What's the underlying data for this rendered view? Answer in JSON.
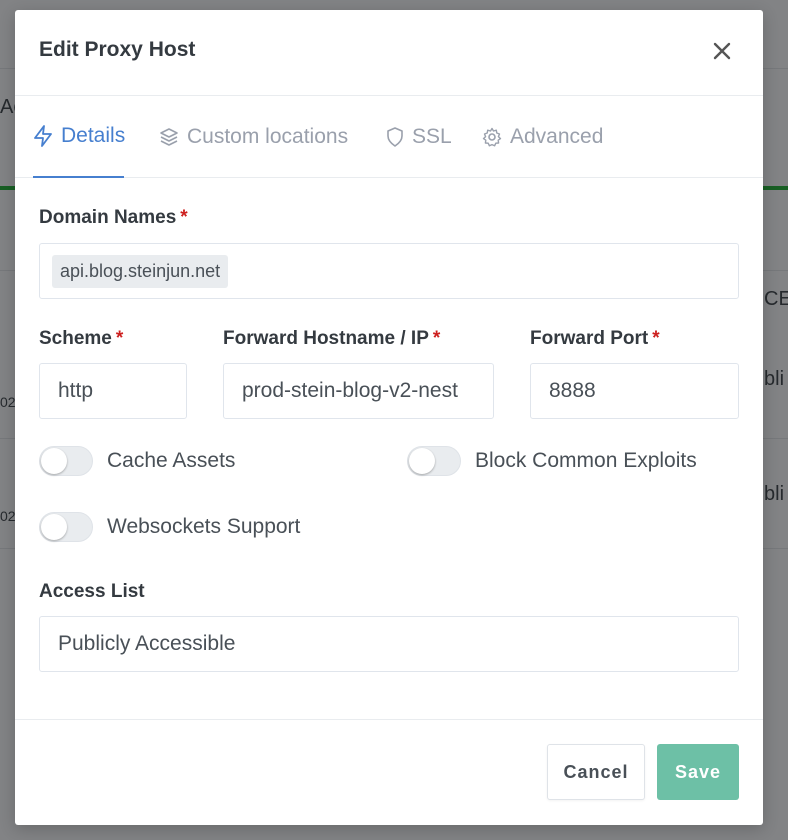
{
  "background": {
    "fragment_a": "Ac",
    "fragment_ce": "CE",
    "fragment_02_1": "02",
    "fragment_02_2": "02",
    "fragment_bli_1": "bli",
    "fragment_bli_2": "bli"
  },
  "modal": {
    "title": "Edit Proxy Host",
    "close_icon": "close-icon"
  },
  "tabs": [
    {
      "label": "Details",
      "icon": "lightning-icon",
      "active": true
    },
    {
      "label": "Custom locations",
      "icon": "layers-icon",
      "active": false
    },
    {
      "label": "SSL",
      "icon": "shield-icon",
      "active": false
    },
    {
      "label": "Advanced",
      "icon": "gear-icon",
      "active": false
    }
  ],
  "form": {
    "required_marker": "*",
    "domain_names": {
      "label": "Domain Names",
      "chips": [
        "api.blog.steinjun.net"
      ]
    },
    "scheme": {
      "label": "Scheme",
      "value": "http"
    },
    "forward_host": {
      "label": "Forward Hostname / IP",
      "value": "prod-stein-blog-v2-nest"
    },
    "forward_port": {
      "label": "Forward Port",
      "value": "8888"
    },
    "toggles": {
      "cache_assets": {
        "label": "Cache Assets",
        "enabled": false
      },
      "block_exploits": {
        "label": "Block Common Exploits",
        "enabled": false
      },
      "websockets": {
        "label": "Websockets Support",
        "enabled": false
      }
    },
    "access_list": {
      "label": "Access List",
      "value": "Publicly Accessible"
    }
  },
  "footer": {
    "cancel_label": "Cancel",
    "save_label": "Save"
  },
  "colors": {
    "accent": "#467fcf",
    "required": "#cd201f",
    "save": "#5eba9d"
  }
}
